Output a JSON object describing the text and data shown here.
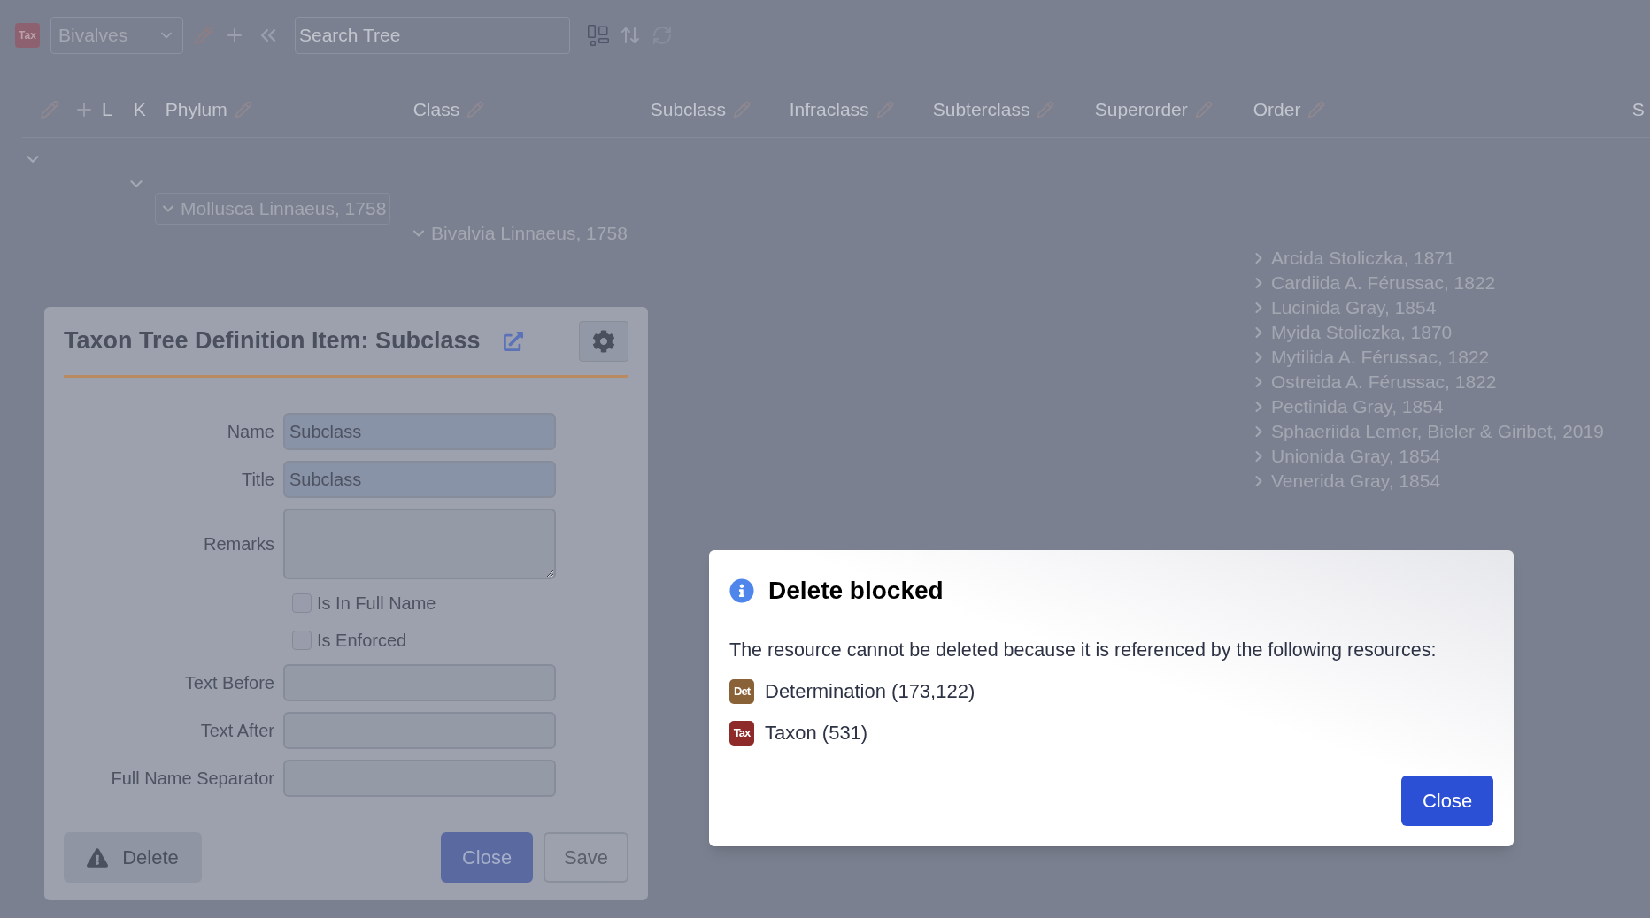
{
  "toolbar": {
    "app_badge": "Tax",
    "tree_select": "Bivalves",
    "search": {
      "placeholder": "Search Tree"
    },
    "refresh_disabled": true
  },
  "column_header": {
    "tools": [
      "L",
      "K"
    ],
    "columns": [
      "Phylum",
      "Class",
      "Subclass",
      "Infraclass",
      "Subterclass",
      "Superorder",
      "Order"
    ],
    "column_8": "S"
  },
  "tree": {
    "expanded": true,
    "children": [
      {
        "expanded": true,
        "children": [
          {
            "label": "Mollusca Linnaeus, 1758",
            "expanded": true,
            "children": [
              {
                "label": "Bivalvia Linnaeus, 1758",
                "expanded": true,
                "children": [
                  {
                    "label": "Arcida Stoliczka, 1871",
                    "expanded": false
                  },
                  {
                    "label": "Cardiida A. Férussac, 1822",
                    "expanded": false
                  },
                  {
                    "label": "Lucinida Gray, 1854",
                    "expanded": false
                  },
                  {
                    "label": "Myida Stoliczka, 1870",
                    "expanded": false
                  },
                  {
                    "label": "Mytilida A. Férussac, 1822",
                    "expanded": false
                  },
                  {
                    "label": "Ostreida A. Férussac, 1822",
                    "expanded": false
                  },
                  {
                    "label": "Pectinida Gray, 1854",
                    "expanded": false
                  },
                  {
                    "label": "Sphaeriida Lemer, Bieler & Giribet, 2019",
                    "expanded": false
                  },
                  {
                    "label": "Unionida Gray, 1854",
                    "expanded": false
                  },
                  {
                    "label": "Venerida Gray, 1854",
                    "expanded": false
                  }
                ]
              }
            ]
          }
        ]
      }
    ]
  },
  "form_dialog": {
    "title": "Taxon Tree Definition Item: Subclass",
    "fields": [
      {
        "kind": "input",
        "label": "Name",
        "value": "Subclass"
      },
      {
        "kind": "input",
        "label": "Title",
        "value": "Subclass"
      },
      {
        "kind": "textarea",
        "label": "Remarks"
      },
      {
        "kind": "checkbox",
        "label": "Is In Full Name",
        "checked": false
      },
      {
        "kind": "checkbox",
        "label": "Is Enforced",
        "checked": false
      },
      {
        "kind": "input",
        "label": "Text Before"
      },
      {
        "kind": "input",
        "label": "Text After"
      },
      {
        "kind": "input",
        "label": "Full Name Separator"
      }
    ],
    "buttons": {
      "delete": "Delete",
      "close": "Close",
      "save": "Save"
    }
  },
  "alert_dialog": {
    "title": "Delete blocked",
    "message": "The resource cannot be deleted because it is referenced by the following resources:",
    "references": [
      {
        "badge": "Det",
        "label": "Determination (173,122)",
        "color": "#8a6237"
      },
      {
        "badge": "Tax",
        "label": "Taxon (531)",
        "color": "#8e2a2a"
      }
    ],
    "close": "Close"
  }
}
